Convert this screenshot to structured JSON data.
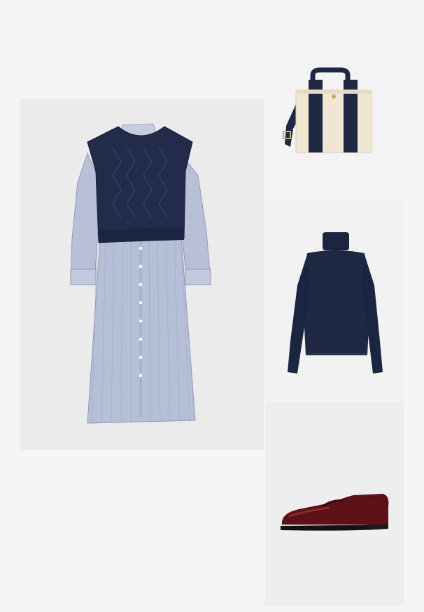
{
  "collage": {
    "items": [
      {
        "name": "shirt-dress-with-knit-vest",
        "icon": "dress-with-vest-illustration"
      },
      {
        "name": "striped-canvas-tote-bag",
        "icon": "tote-bag-illustration"
      },
      {
        "name": "navy-turtleneck-top",
        "icon": "turtleneck-illustration"
      },
      {
        "name": "burgundy-penny-loafer",
        "icon": "loafer-illustration"
      }
    ],
    "colors": {
      "navy": "#1e2843",
      "stripe_blue": "#a9b3cf",
      "canvas": "#f0e7d3",
      "burgundy": "#5c1216"
    }
  }
}
